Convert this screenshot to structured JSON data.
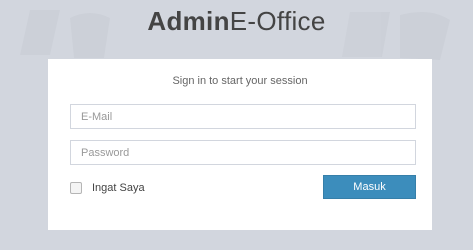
{
  "logo": {
    "bold": "Admin",
    "light": "E-Office"
  },
  "login_box": {
    "message": "Sign in to start your session",
    "email": {
      "placeholder": "E-Mail",
      "value": ""
    },
    "password": {
      "placeholder": "Password",
      "value": ""
    },
    "remember_label": "Ingat Saya",
    "remember_checked": false,
    "submit_label": "Masuk"
  },
  "colors": {
    "background": "#d2d6de",
    "primary_button": "#3c8dbc",
    "box": "#ffffff"
  }
}
